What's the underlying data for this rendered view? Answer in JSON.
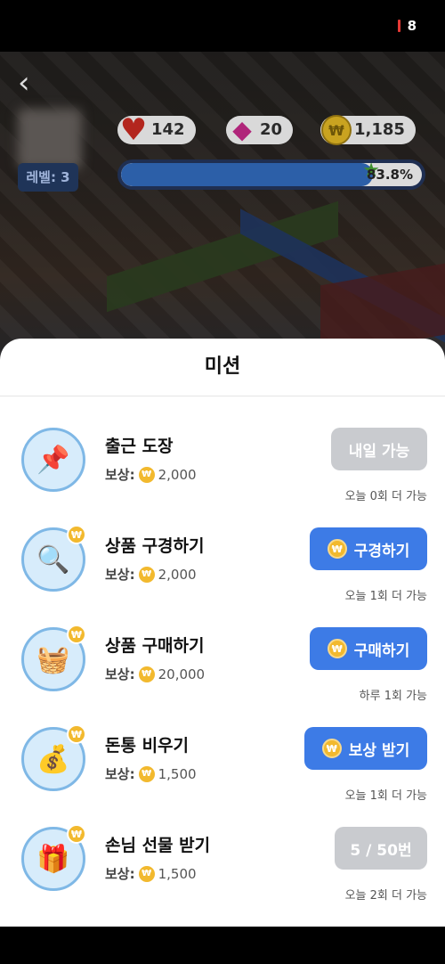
{
  "status": {
    "battery": "8"
  },
  "hud": {
    "level_label": "레벨: 3",
    "hearts": "142",
    "gems": "20",
    "coins": "1,185",
    "progress_text": "83.8%",
    "progress_value": 0.838,
    "coin_symbol": "₩"
  },
  "sheet": {
    "title": "미션",
    "reward_label": "보상:",
    "coin_symbol": "₩",
    "missions": [
      {
        "icon": "pin-stamp-icon",
        "name": "출근 도장",
        "reward": "2,000",
        "button": "내일 가능",
        "button_style": "gray",
        "button_coin": false,
        "note": "오늘 0회 더 가능"
      },
      {
        "icon": "magnifier-icon",
        "name": "상품 구경하기",
        "reward": "2,000",
        "button": "구경하기",
        "button_style": "blue",
        "button_coin": true,
        "note": "오늘 1회 더 가능"
      },
      {
        "icon": "shopping-basket-icon",
        "name": "상품 구매하기",
        "reward": "20,000",
        "button": "구매하기",
        "button_style": "blue",
        "button_coin": true,
        "note": "하루 1회 가능"
      },
      {
        "icon": "coin-pile-icon",
        "name": "돈통 비우기",
        "reward": "1,500",
        "button": "보상 받기",
        "button_style": "blue",
        "button_coin": true,
        "note": "오늘 1회 더 가능"
      },
      {
        "icon": "gift-box-icon",
        "name": "손님 선물 받기",
        "reward": "1,500",
        "button": "5 / 50번",
        "button_style": "gray",
        "button_coin": false,
        "note": "오늘 2회 더 가능"
      }
    ]
  }
}
